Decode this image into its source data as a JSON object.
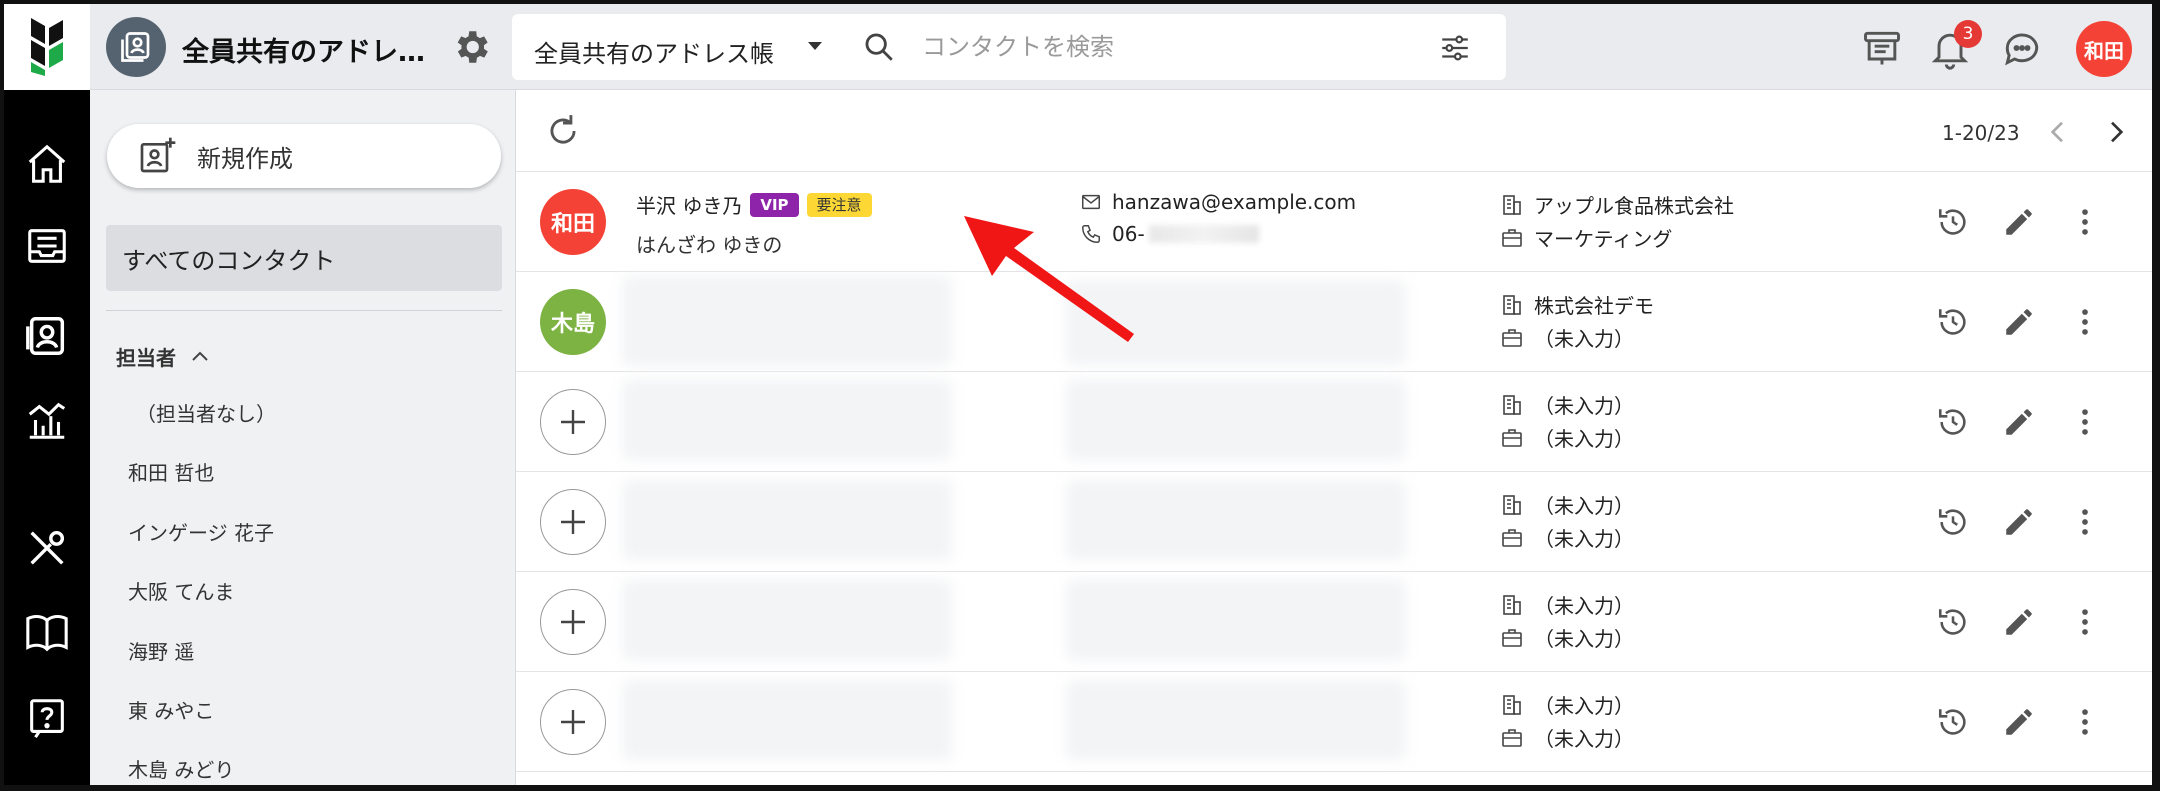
{
  "header": {
    "book_title": "全員共有のアドレ…",
    "book_select": "全員共有のアドレス帳",
    "search_placeholder": "コンタクトを検索",
    "notification_count": "3",
    "user_initials": "和田"
  },
  "sidebar": {
    "new_button": "新規作成",
    "all_contacts": "すべてのコンタクト",
    "owner_section": "担当者",
    "owners": [
      "（担当者なし）",
      "和田 哲也",
      "インゲージ 花子",
      "大阪 てんま",
      "海野 遥",
      "東 みやこ",
      "木島 みどり"
    ]
  },
  "list": {
    "range": "1-20/23",
    "rows": [
      {
        "avatar": "和田",
        "name": "半沢 ゆき乃",
        "tags": [
          "VIP",
          "要注意"
        ],
        "kana": "はんざわ ゆきの",
        "email": "hanzawa@example.com",
        "phone": "06-",
        "company": "アップル食品株式会社",
        "department": "マーケティング"
      },
      {
        "avatar": "木島",
        "company": "株式会社デモ",
        "department": "（未入力）"
      },
      {
        "avatar": "",
        "company": "（未入力）",
        "department": "（未入力）"
      },
      {
        "avatar": "",
        "company": "（未入力）",
        "department": "（未入力）"
      },
      {
        "avatar": "",
        "company": "（未入力）",
        "department": "（未入力）"
      },
      {
        "avatar": "",
        "company": "（未入力）",
        "department": "（未入力）"
      }
    ]
  },
  "colors": {
    "accent_red": "#f44336",
    "avatar_green": "#7cb342",
    "vip_purple": "#8e24aa",
    "caution_yellow": "#fdd835",
    "annotation_arrow": "#f01616"
  }
}
